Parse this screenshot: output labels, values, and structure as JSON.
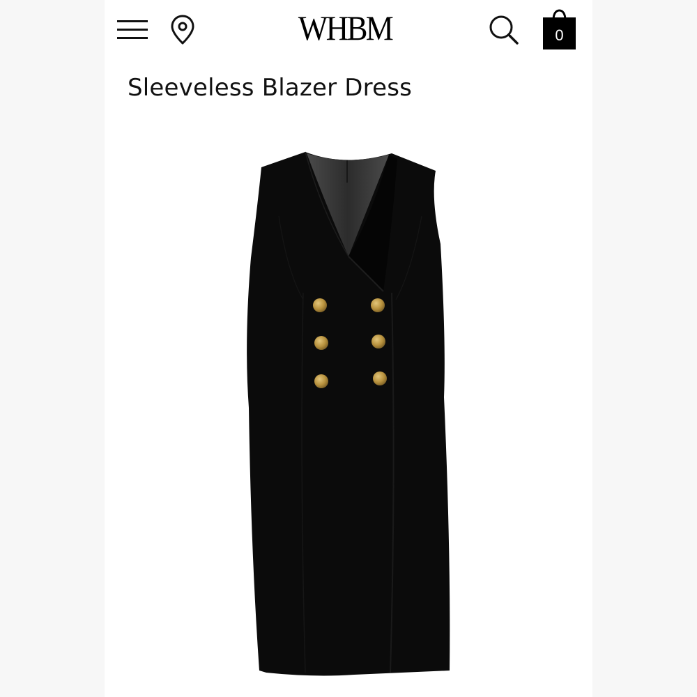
{
  "header": {
    "logo_text": "WHBM",
    "menu_icon": "hamburger-menu-icon",
    "store_icon": "map-pin-icon",
    "search_icon": "search-icon",
    "cart_icon": "shopping-bag-icon",
    "cart_count": "0"
  },
  "product": {
    "title": "Sleeveless Blazer Dress",
    "image": {
      "garment_color": "#0b0b0b",
      "button_color": "#b8923e",
      "lining_color": "#3a3a3a"
    }
  },
  "colors": {
    "page_background": "#ffffff",
    "gutter": "#f7f7f7",
    "text": "#111111",
    "cart_badge": "#000000"
  }
}
